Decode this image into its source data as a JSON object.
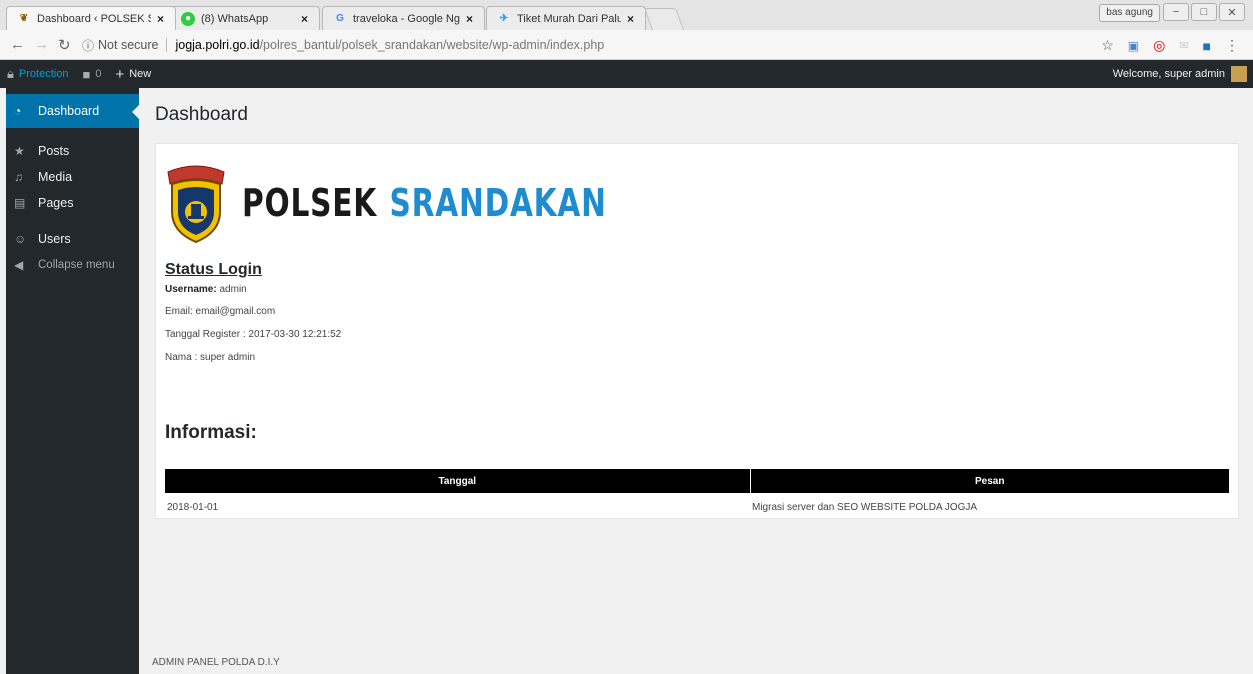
{
  "browser": {
    "tabs": [
      {
        "title": "Dashboard ‹ POLSEK SRA",
        "icon": "police-badge-icon",
        "active": true
      },
      {
        "title": "(8) WhatsApp",
        "icon": "whatsapp-icon",
        "active": false
      },
      {
        "title": "traveloka - Google Nggo",
        "icon": "google-icon",
        "active": false
      },
      {
        "title": "Tiket Murah Dari Palu ke",
        "icon": "traveloka-icon",
        "active": false
      }
    ],
    "close_glyph": "×",
    "profile_name": "bas agung",
    "address": {
      "security_label": "Not secure",
      "host": "jogja.polri.go.id",
      "path": "/polres_bantul/polsek_srandakan/website/wp-admin/index.php"
    }
  },
  "adminbar": {
    "protection_label": "Protection",
    "comments_count": "0",
    "new_label": "New",
    "welcome_text": "Welcome, super admin"
  },
  "menu": {
    "items": [
      {
        "label": "Dashboard",
        "icon": "dashboard-icon"
      },
      {
        "label": "Posts",
        "icon": "pin-icon"
      },
      {
        "label": "Media",
        "icon": "media-icon"
      },
      {
        "label": "Pages",
        "icon": "pages-icon"
      },
      {
        "label": "Users",
        "icon": "users-icon"
      },
      {
        "label": "Collapse menu",
        "icon": "collapse-icon"
      }
    ]
  },
  "page": {
    "title": "Dashboard",
    "logo": {
      "badge_text": "D.I.YOGYAKARTA",
      "word1": "POLSEK",
      "word2": "SRANDAKAN"
    },
    "status": {
      "heading": "Status Login",
      "username_label": "Username:",
      "username_value": "admin",
      "email": "Email: email@gmail.com",
      "tanggal_register": "Tanggal Register : 2017-03-30 12:21:52",
      "nama": "Nama : super admin"
    },
    "informasi": {
      "heading": "Informasi:",
      "columns": [
        "Tanggal",
        "Pesan"
      ],
      "rows": [
        {
          "tanggal": "2018-01-01",
          "pesan": "Migrasi server dan SEO WEBSITE POLDA JOGJA"
        }
      ]
    }
  },
  "footer": {
    "text": "ADMIN PANEL POLDA D.I.Y"
  },
  "colors": {
    "admin_dark": "#23282d",
    "accent_blue": "#0073aa",
    "logo_blue": "#1f8ccf",
    "content_bg": "#f1f1f1"
  }
}
